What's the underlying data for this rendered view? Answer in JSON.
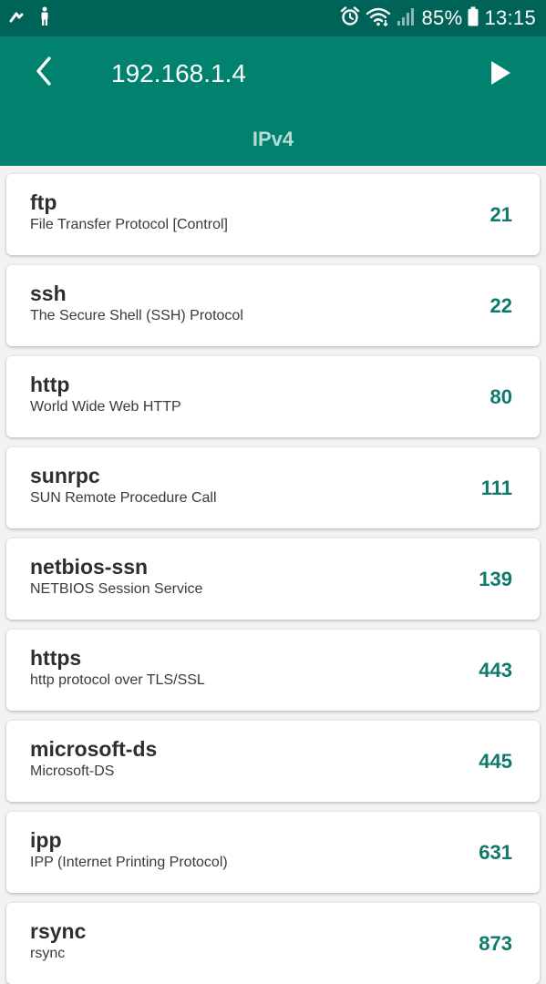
{
  "status_bar": {
    "left_icons": [
      "upload-notification-icon",
      "accessibility-icon"
    ],
    "right_icons": [
      "alarm-icon",
      "wifi-icon",
      "signal-icon",
      "battery-icon"
    ],
    "battery": "85%",
    "time": "13:15"
  },
  "app_bar": {
    "title": "192.168.1.4",
    "subtitle": "IPv4",
    "back_icon": "back-arrow-icon",
    "play_icon": "play-icon"
  },
  "colors": {
    "status_bar": "#006357",
    "app_bar": "#00826f",
    "port_text": "#0f7a6c",
    "background": "#f2f2f2"
  },
  "services": [
    {
      "name": "ftp",
      "description": "File Transfer Protocol [Control]",
      "port": "21"
    },
    {
      "name": "ssh",
      "description": "The Secure Shell (SSH) Protocol",
      "port": "22"
    },
    {
      "name": "http",
      "description": "World Wide Web HTTP",
      "port": "80"
    },
    {
      "name": "sunrpc",
      "description": "SUN Remote Procedure Call",
      "port": "111"
    },
    {
      "name": "netbios-ssn",
      "description": "NETBIOS Session Service",
      "port": "139"
    },
    {
      "name": "https",
      "description": "http protocol over TLS/SSL",
      "port": "443"
    },
    {
      "name": "microsoft-ds",
      "description": "Microsoft-DS",
      "port": "445"
    },
    {
      "name": "ipp",
      "description": "IPP (Internet Printing Protocol)",
      "port": "631"
    },
    {
      "name": "rsync",
      "description": "rsync",
      "port": "873"
    }
  ]
}
